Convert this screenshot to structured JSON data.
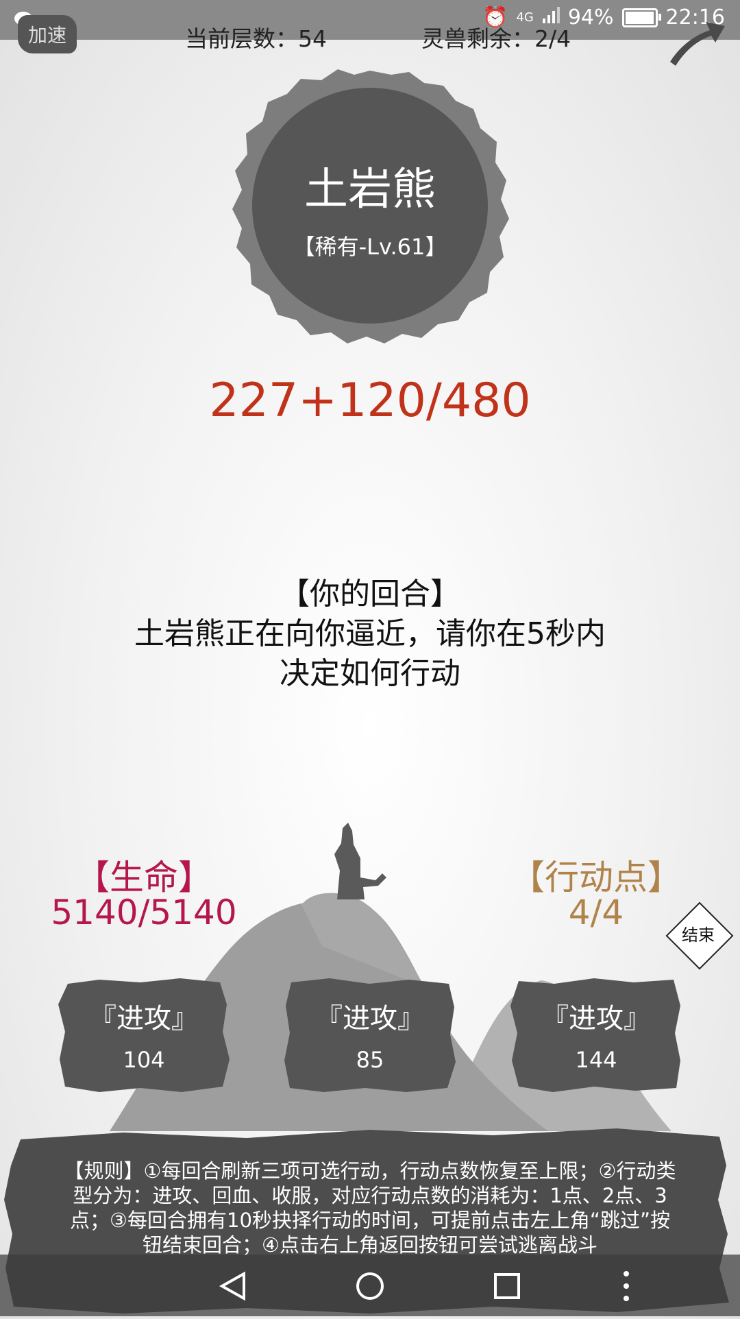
{
  "status_bar": {
    "battery": "94%",
    "time": "22:16",
    "network": "4G"
  },
  "header": {
    "speed_label": "加速",
    "floor_label": "当前层数：",
    "floor_value": "54",
    "beasts_label": "灵兽剩余：",
    "beasts_value": "2/4"
  },
  "enemy": {
    "name": "土岩熊",
    "rank": "【稀有-Lv.61】",
    "hp": "227+120/480"
  },
  "turn": {
    "title": "【你的回合】",
    "line1": "土岩熊正在向你逼近，请你在5秒内",
    "line2": "决定如何行动"
  },
  "player": {
    "life_label": "【生命】",
    "life_value": "5140/5140",
    "ap_label": "【行动点】",
    "ap_value": "4/4",
    "end_label": "结束"
  },
  "actions": [
    {
      "label": "『进攻』",
      "value": "104"
    },
    {
      "label": "『进攻』",
      "value": "85"
    },
    {
      "label": "『进攻』",
      "value": "144"
    }
  ],
  "rules": {
    "text": "【规则】①每回合刷新三项可选行动，行动点数恢复至上限；②行动类型分为：进攻、回血、收服，对应行动点数的消耗为：1点、2点、3点；③每回合拥有10秒抉择行动的时间，可提前点击左上角“跳过”按钮结束回合；④点击右上角返回按钮可尝试逃离战斗"
  },
  "colors": {
    "hp_red": "#c0321a",
    "life_red": "#b5174a",
    "ap_gold": "#b0834a",
    "ink": "#555555"
  }
}
